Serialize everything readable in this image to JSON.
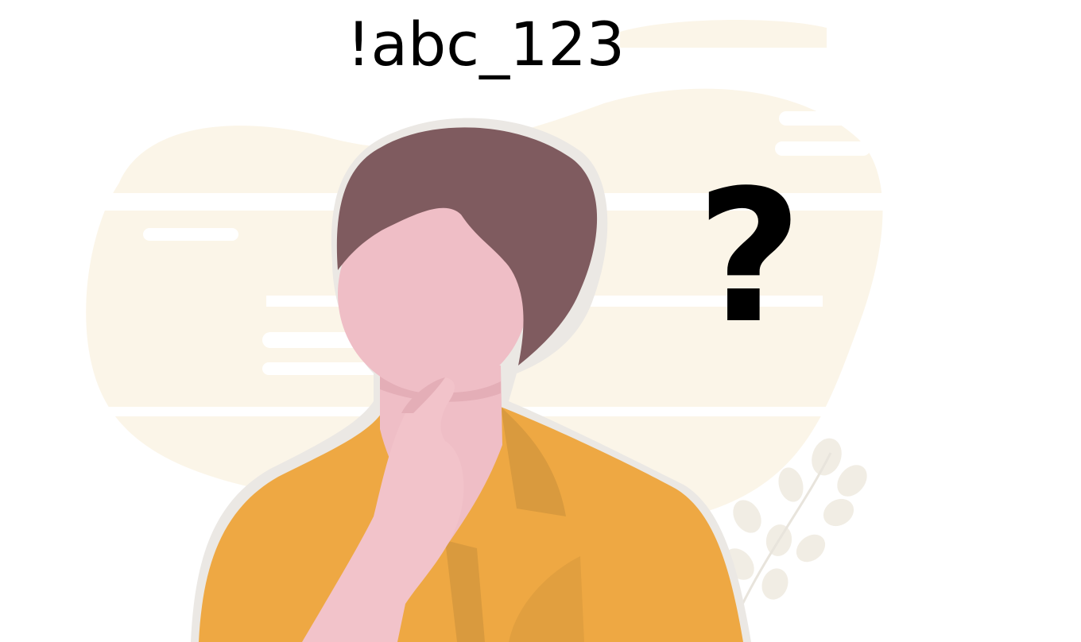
{
  "caption": {
    "text": "!abc_123"
  },
  "symbol": {
    "text": "?"
  },
  "illustration": {
    "subject": "thinking-person",
    "colors": {
      "background_blob": "#fbf5e8",
      "hair": "#7f5b5f",
      "skin": "#efbec6",
      "skin_shade": "#e4aeb7",
      "shirt": "#eea843",
      "shirt_shade": "#d99a3e",
      "outline": "#ebe8e4",
      "plant": "#f1ede4"
    }
  }
}
